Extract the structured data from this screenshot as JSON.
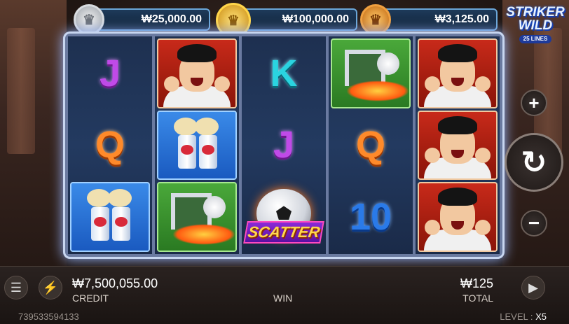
{
  "jackpots": [
    {
      "tier": "silver",
      "amount": "₩25,000.00"
    },
    {
      "tier": "gold",
      "amount": "₩100,000.00"
    },
    {
      "tier": "bronze",
      "amount": "₩3,125.00"
    }
  ],
  "logo": {
    "line1": "STRIKER",
    "line2": "WILD",
    "line3": "25 LINES"
  },
  "reels": [
    [
      "J",
      "Q",
      "DRINKS"
    ],
    [
      "PLAYER",
      "DRINKS",
      "GOAL"
    ],
    [
      "K",
      "J",
      "SCATTER"
    ],
    [
      "GOAL",
      "Q",
      "10"
    ],
    [
      "PLAYER",
      "PLAYER",
      "PLAYER"
    ]
  ],
  "scatter_label": "SCATTER",
  "controls": {
    "plus_icon": "+",
    "minus_icon": "−",
    "spin_icon": "↻",
    "menu_icon": "☰",
    "turbo_icon": "⚡",
    "autoplay_icon": "▶"
  },
  "credit": {
    "value": "₩7,500,055.00",
    "label": "CREDIT"
  },
  "win": {
    "label": "WIN"
  },
  "total": {
    "value": "₩125",
    "label": "TOTAL"
  },
  "session_id": "739533594133",
  "level": {
    "label": "LEVEL :",
    "value": "X5"
  },
  "colors": {
    "accent": "#6aa6d8",
    "frame_glow": "#9ab8ff"
  }
}
